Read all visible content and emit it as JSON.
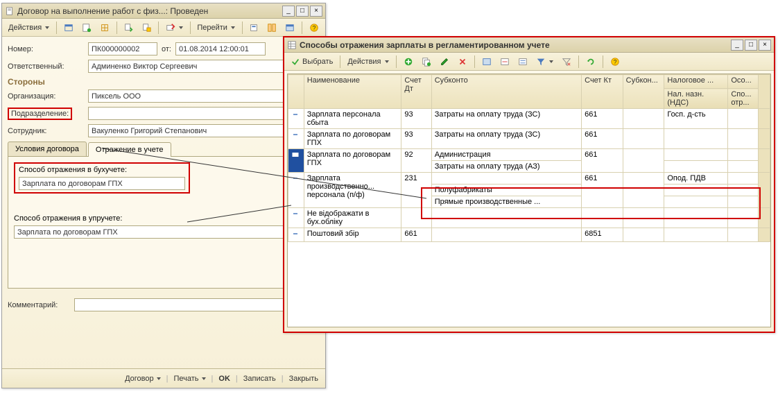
{
  "window1": {
    "title": "Договор на выполнение работ с физ...: Проведен",
    "toolbar": {
      "actions": "Действия",
      "goto": "Перейти"
    },
    "number_label": "Номер:",
    "number_value": "ПК000000002",
    "from_label": "от:",
    "date_value": "01.08.2014 12:00:01",
    "responsible_label": "Ответственный:",
    "responsible_value": "Админенко Виктор Сергеевич",
    "sides_title": "Стороны",
    "org_label": "Организация:",
    "org_value": "Пиксель ООО",
    "dept_label": "Подразделение:",
    "employee_label": "Сотрудник:",
    "employee_value": "Вакуленко Григорий Степанович",
    "tab1": "Условия договора",
    "tab2": "Отражение в учете",
    "method_bu_label": "Способ отражения в бухучете:",
    "method_bu_value": "Зарплата по договорам ГПХ",
    "method_upr_label": "Способ отражения в упручете:",
    "method_upr_value": "Зарплата по договорам ГПХ",
    "comment_label": "Комментарий:",
    "bottom": {
      "contract": "Договор",
      "print": "Печать",
      "ok": "OK",
      "save": "Записать",
      "close": "Закрыть"
    }
  },
  "window2": {
    "title": "Способы отражения зарплаты в регламентированном учете",
    "toolbar": {
      "select": "Выбрать",
      "actions": "Действия"
    },
    "headers": {
      "name": "Наименование",
      "acc_dt": "Счет Дт",
      "subconto": "Субконто",
      "acc_kt": "Счет Кт",
      "subkon": "Субкон...",
      "tax": "Налоговое ...",
      "oso": "Осо...",
      "nal_nazn": "Нал. назн. (НДС)",
      "spo": "Спо... отр..."
    },
    "rows": [
      {
        "name": "Зарплата персонала сбыта",
        "dt": "93",
        "sub": [
          "Затраты на оплату труда (ЗС)"
        ],
        "kt": "661",
        "subk": "",
        "tax": "Госп. д-сть",
        "oso": ""
      },
      {
        "name": "Зарплата по договорам ГПХ",
        "dt": "93",
        "sub": [
          "Затраты на оплату труда (ЗС)"
        ],
        "kt": "661",
        "subk": "",
        "tax": "",
        "oso": ""
      },
      {
        "name": "Зарплата по договорам ГПХ",
        "dt": "92",
        "sub": [
          "Администрация",
          "Затраты на оплату труда (АЗ)"
        ],
        "kt": "661",
        "subk": "",
        "tax": "",
        "oso": ""
      },
      {
        "name": "Зарплата производственно... персонала (п/ф)",
        "dt": "231",
        "sub": [
          "",
          "Полуфабрикаты",
          "Прямые производственные ..."
        ],
        "kt": "661",
        "subk": "",
        "tax": "Опод. ПДВ",
        "oso": ""
      },
      {
        "name": "Не відображати в бух.обліку",
        "dt": "",
        "sub": [
          ""
        ],
        "kt": "",
        "subk": "",
        "tax": "",
        "oso": ""
      },
      {
        "name": "Поштовий збір",
        "dt": "661",
        "sub": [
          ""
        ],
        "kt": "6851",
        "subk": "",
        "tax": "",
        "oso": ""
      }
    ]
  }
}
